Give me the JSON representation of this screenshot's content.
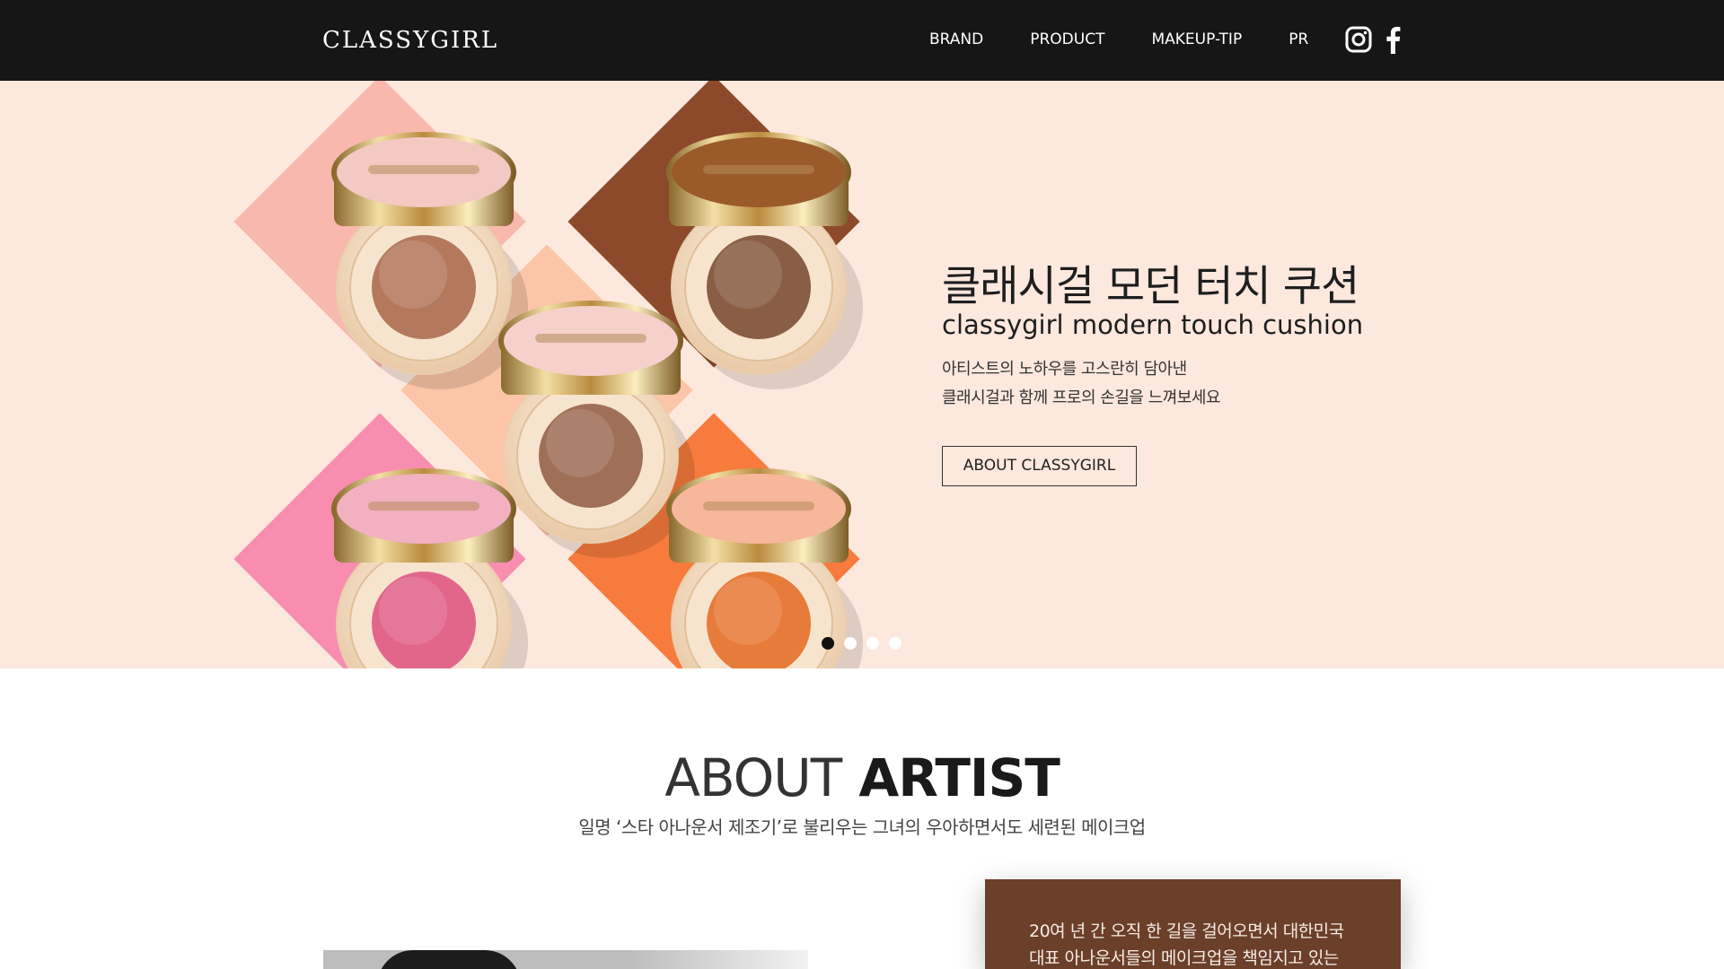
{
  "header": {
    "logo": "CLASSYGIRL",
    "nav": [
      "BRAND",
      "PRODUCT",
      "MAKEUP-TIP",
      "PR"
    ],
    "social_icons": [
      "instagram-icon",
      "facebook-icon"
    ]
  },
  "hero": {
    "title_ko": "클래시걸 모던 터치 쿠션",
    "title_en": "classygirl modern touch cushion",
    "desc_line1": "아티스트의 노하우를 고스란히 담아낸",
    "desc_line2": "클래시걸과 함께 프로의 손길을 느껴보세요",
    "button": "ABOUT CLASSYGIRL",
    "slides_total": 4,
    "slide_active": 1,
    "product_tile_colors": [
      "#f9b8ad",
      "#8d4a2a",
      "#fcc5a7",
      "#f98db0",
      "#f77b3c"
    ],
    "cushion_colors": [
      "#b4795d",
      "#8a5e45",
      "#a06f58",
      "#e2668a",
      "#e77c3a"
    ],
    "brand_engraving": "CLASSYGIRL"
  },
  "about": {
    "title_light": "ABOUT",
    "title_bold": "ARTIST",
    "subtitle": "일명 ‘스타 아나운서 제조기’로 불리우는 그녀의  우아하면서도 세련된 메이크업",
    "bio_line1": "20여 년 간 오직 한 길을 걸어오면서 대한민국",
    "bio_line2": "대표 아나운서들의 메이크업을 책임지고 있는"
  },
  "colors": {
    "header_bg": "#161616",
    "hero_bg": "#fde8dd",
    "bio_bg": "#6b3f2a"
  }
}
